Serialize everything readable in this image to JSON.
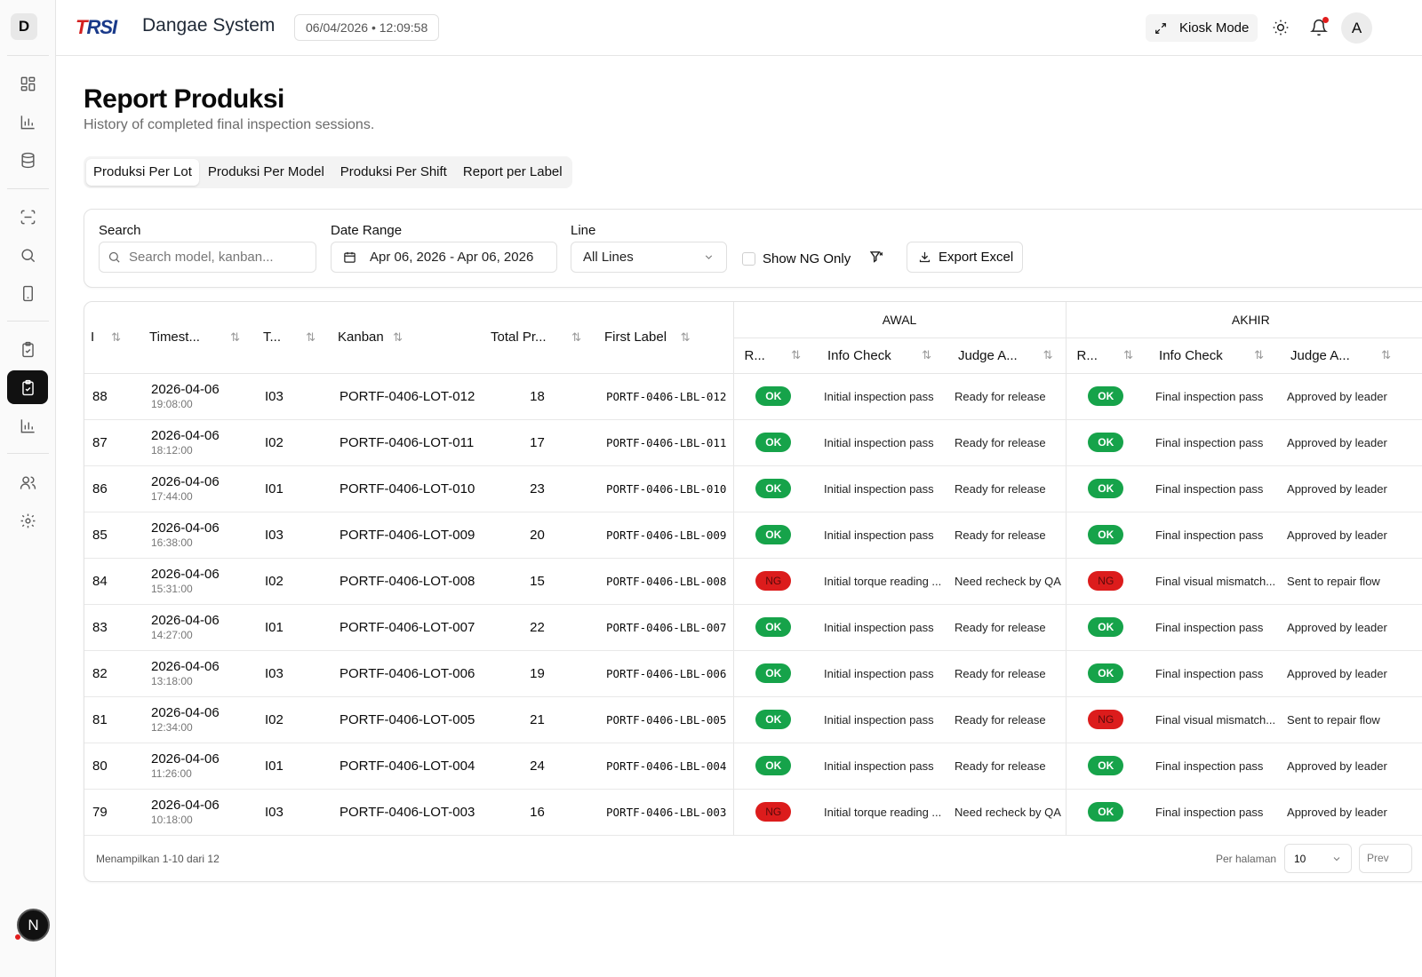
{
  "sidebar": {
    "logo_letter": "D",
    "bottom_badge": "N"
  },
  "header": {
    "brand": "TRSI",
    "title": "Dangae System",
    "datetime": "06/04/2026 • 12:09:58",
    "kiosk_label": "Kiosk Mode",
    "avatar_letter": "A"
  },
  "page": {
    "title": "Report Produksi",
    "subtitle": "History of completed final inspection sessions."
  },
  "tabs": [
    "Produksi Per Lot",
    "Produksi Per Model",
    "Produksi Per Shift",
    "Report per Label"
  ],
  "filters": {
    "search_label": "Search",
    "search_placeholder": "Search model, kanban...",
    "date_label": "Date Range",
    "date_value": "Apr 06, 2026 - Apr 06, 2026",
    "line_label": "Line",
    "line_value": "All Lines",
    "ng_only_label": "Show NG Only",
    "export_label": "Export Excel"
  },
  "table": {
    "headers": {
      "id": "I",
      "timestamp": "Timest...",
      "type": "T...",
      "kanban": "Kanban",
      "total": "Total Pr...",
      "first_label": "First Label",
      "awal": "AWAL",
      "akhir": "AKHIR",
      "result": "R...",
      "info_check": "Info Check",
      "judge": "Judge A..."
    },
    "rows": [
      {
        "id": "88",
        "date": "2026-04-06",
        "time": "19:08:00",
        "type": "I03",
        "kanban": "PORTF-0406-LOT-012",
        "total": "18",
        "label": "PORTF-0406-LBL-012",
        "awal_r": "OK",
        "awal_info": "Initial inspection pass",
        "awal_judge": "Ready for release",
        "akhir_r": "OK",
        "akhir_info": "Final inspection pass",
        "akhir_judge": "Approved by leader"
      },
      {
        "id": "87",
        "date": "2026-04-06",
        "time": "18:12:00",
        "type": "I02",
        "kanban": "PORTF-0406-LOT-011",
        "total": "17",
        "label": "PORTF-0406-LBL-011",
        "awal_r": "OK",
        "awal_info": "Initial inspection pass",
        "awal_judge": "Ready for release",
        "akhir_r": "OK",
        "akhir_info": "Final inspection pass",
        "akhir_judge": "Approved by leader"
      },
      {
        "id": "86",
        "date": "2026-04-06",
        "time": "17:44:00",
        "type": "I01",
        "kanban": "PORTF-0406-LOT-010",
        "total": "23",
        "label": "PORTF-0406-LBL-010",
        "awal_r": "OK",
        "awal_info": "Initial inspection pass",
        "awal_judge": "Ready for release",
        "akhir_r": "OK",
        "akhir_info": "Final inspection pass",
        "akhir_judge": "Approved by leader"
      },
      {
        "id": "85",
        "date": "2026-04-06",
        "time": "16:38:00",
        "type": "I03",
        "kanban": "PORTF-0406-LOT-009",
        "total": "20",
        "label": "PORTF-0406-LBL-009",
        "awal_r": "OK",
        "awal_info": "Initial inspection pass",
        "awal_judge": "Ready for release",
        "akhir_r": "OK",
        "akhir_info": "Final inspection pass",
        "akhir_judge": "Approved by leader"
      },
      {
        "id": "84",
        "date": "2026-04-06",
        "time": "15:31:00",
        "type": "I02",
        "kanban": "PORTF-0406-LOT-008",
        "total": "15",
        "label": "PORTF-0406-LBL-008",
        "awal_r": "NG",
        "awal_info": "Initial torque reading ...",
        "awal_judge": "Need recheck by QA",
        "akhir_r": "NG",
        "akhir_info": "Final visual mismatch...",
        "akhir_judge": "Sent to repair flow"
      },
      {
        "id": "83",
        "date": "2026-04-06",
        "time": "14:27:00",
        "type": "I01",
        "kanban": "PORTF-0406-LOT-007",
        "total": "22",
        "label": "PORTF-0406-LBL-007",
        "awal_r": "OK",
        "awal_info": "Initial inspection pass",
        "awal_judge": "Ready for release",
        "akhir_r": "OK",
        "akhir_info": "Final inspection pass",
        "akhir_judge": "Approved by leader"
      },
      {
        "id": "82",
        "date": "2026-04-06",
        "time": "13:18:00",
        "type": "I03",
        "kanban": "PORTF-0406-LOT-006",
        "total": "19",
        "label": "PORTF-0406-LBL-006",
        "awal_r": "OK",
        "awal_info": "Initial inspection pass",
        "awal_judge": "Ready for release",
        "akhir_r": "OK",
        "akhir_info": "Final inspection pass",
        "akhir_judge": "Approved by leader"
      },
      {
        "id": "81",
        "date": "2026-04-06",
        "time": "12:34:00",
        "type": "I02",
        "kanban": "PORTF-0406-LOT-005",
        "total": "21",
        "label": "PORTF-0406-LBL-005",
        "awal_r": "OK",
        "awal_info": "Initial inspection pass",
        "awal_judge": "Ready for release",
        "akhir_r": "NG",
        "akhir_info": "Final visual mismatch...",
        "akhir_judge": "Sent to repair flow"
      },
      {
        "id": "80",
        "date": "2026-04-06",
        "time": "11:26:00",
        "type": "I01",
        "kanban": "PORTF-0406-LOT-004",
        "total": "24",
        "label": "PORTF-0406-LBL-004",
        "awal_r": "OK",
        "awal_info": "Initial inspection pass",
        "awal_judge": "Ready for release",
        "akhir_r": "OK",
        "akhir_info": "Final inspection pass",
        "akhir_judge": "Approved by leader"
      },
      {
        "id": "79",
        "date": "2026-04-06",
        "time": "10:18:00",
        "type": "I03",
        "kanban": "PORTF-0406-LOT-003",
        "total": "16",
        "label": "PORTF-0406-LBL-003",
        "awal_r": "NG",
        "awal_info": "Initial torque reading ...",
        "awal_judge": "Need recheck by QA",
        "akhir_r": "OK",
        "akhir_info": "Final inspection pass",
        "akhir_judge": "Approved by leader"
      }
    ],
    "footer": {
      "showing": "Menampilkan 1-10 dari 12",
      "per_page_label": "Per halaman",
      "per_page_value": "10",
      "prev_label": "Prev"
    }
  },
  "colors": {
    "ok": "#16a34a",
    "ng": "#dc1c1c",
    "active_nav": "#111111"
  }
}
